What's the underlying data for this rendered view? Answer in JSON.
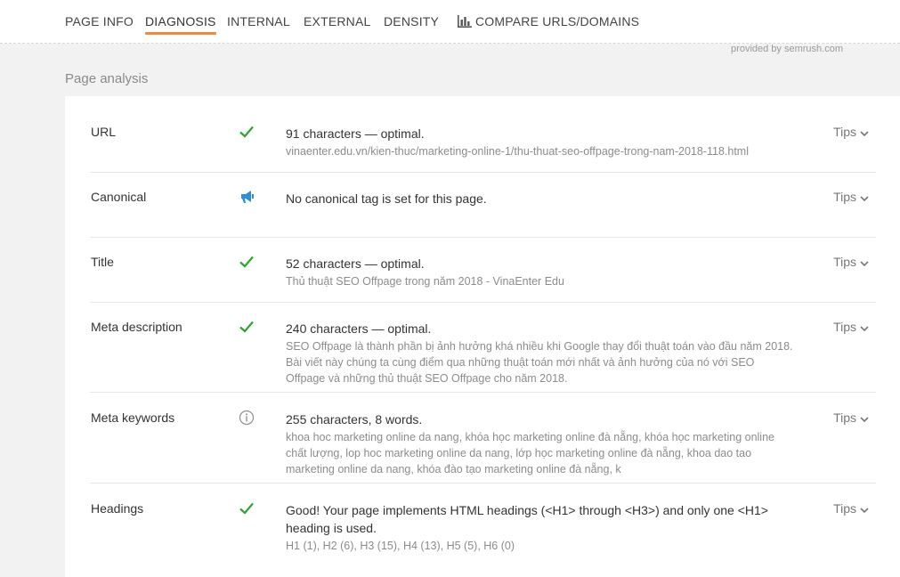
{
  "tabs": [
    {
      "label": "PAGE INFO"
    },
    {
      "label": "DIAGNOSIS"
    },
    {
      "label": "INTERNAL"
    },
    {
      "label": "EXTERNAL"
    },
    {
      "label": "DENSITY"
    },
    {
      "label": "COMPARE URLS/DOMAINS"
    }
  ],
  "active_tab": "DIAGNOSIS",
  "provided_by": "provided by  semrush.com",
  "section_title": "Page analysis",
  "colors": {
    "accent": "#f08a3c",
    "ok": "#2fa52f",
    "warn": "#2d8fd5",
    "info": "#8f8f8f"
  },
  "rows": [
    {
      "label": "URL",
      "status": "check-icon",
      "main": "91 characters — optimal.",
      "sub": "vinaenter.edu.vn/kien-thuc/marketing-online-1/thu-thuat-seo-offpage-trong-nam-2018-118.html",
      "tips": "Tips"
    },
    {
      "label": "Canonical",
      "status": "megaphone-icon",
      "main": "No canonical tag is set for this page.",
      "sub": "",
      "tips": "Tips"
    },
    {
      "label": "Title",
      "status": "check-icon",
      "main": "52 characters — optimal.",
      "sub": "Thủ thuật SEO Offpage trong năm 2018 - VinaEnter Edu",
      "tips": "Tips"
    },
    {
      "label": "Meta description",
      "status": "check-icon",
      "main": "240 characters — optimal.",
      "sub": "SEO Offpage là thành phần bị ảnh hưởng khá nhiều khi Google thay đổi thuật toán vào đầu năm 2018. Bài viết này chúng ta cùng điểm qua những thuật toán mới nhất và ảnh hưởng của nó với SEO Offpage và những thủ thuật SEO Offpage cho năm 2018.",
      "tips": "Tips"
    },
    {
      "label": "Meta keywords",
      "status": "info-icon",
      "main": "255 characters, 8 words.",
      "sub": "khoa hoc marketing online da nang, khóa học marketing online đà nẵng, khóa học marketing online chất lượng, lop hoc marketing online da nang, lớp học marketing online đà nẵng, khoa dao tao marketing online da nang, khóa đào tạo marketing online đà nẵng, k",
      "tips": "Tips"
    },
    {
      "label": "Headings",
      "status": "check-icon",
      "main": "Good! Your page implements HTML headings (<H1> through <H3>) and only one <H1> heading is used.",
      "sub": "H1 (1), H2 (6), H3 (15), H4 (13), H5 (5), H6 (0)",
      "tips": "Tips"
    }
  ]
}
